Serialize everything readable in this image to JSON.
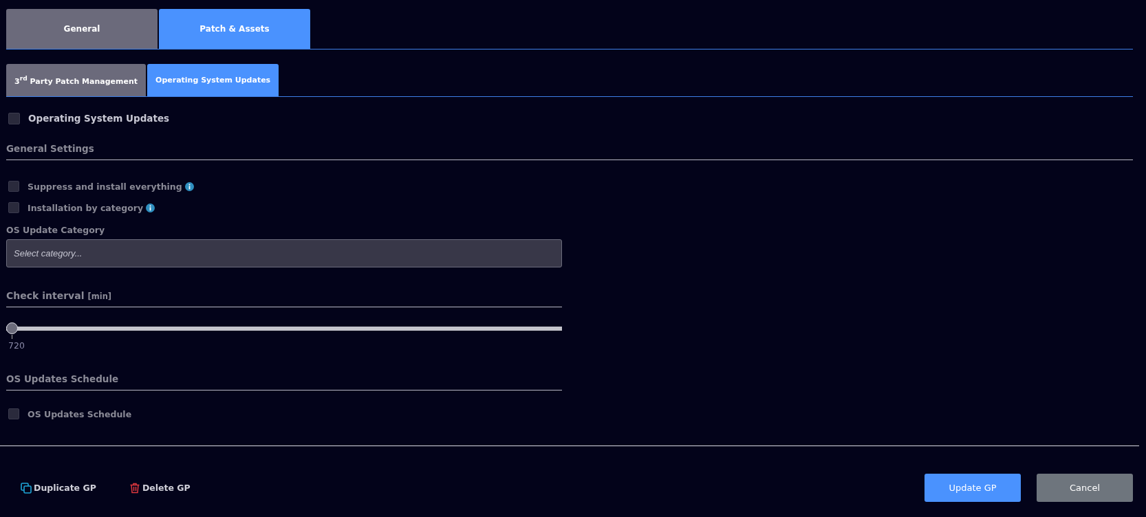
{
  "tabs": [
    {
      "label": "General",
      "selected": false
    },
    {
      "label": "Patch & Assets",
      "selected": true
    }
  ],
  "subtabs": [
    {
      "label": "3$^{rd}$ Party Patch Management",
      "selected": false
    },
    {
      "label": "Operating System Updates",
      "selected": true
    }
  ],
  "main_toggle": {
    "label": "Operating System Updates",
    "checked": false
  },
  "general_settings": {
    "heading": "General Settings",
    "options": [
      {
        "label": "Suppress and install everything",
        "checked": false,
        "info": true
      },
      {
        "label": "Installation by category",
        "checked": false,
        "info": true
      }
    ]
  },
  "category": {
    "label": "OS Update Category",
    "placeholder": "Select category..."
  },
  "check_interval": {
    "heading": "Check interval",
    "unit": "[min]",
    "level": 0,
    "reading": "720"
  },
  "schedule": {
    "heading": "OS Updates Schedule",
    "option": {
      "label": "OS Updates Schedule",
      "checked": false
    }
  },
  "footer": {
    "actions": [
      {
        "kind": "duplicate",
        "label": "Duplicate GP"
      },
      {
        "kind": "delete",
        "label": "Delete GP"
      }
    ],
    "buttons": [
      {
        "kind": "primary",
        "label": "Update GP"
      },
      {
        "kind": "secondary",
        "label": "Cancel"
      }
    ]
  }
}
